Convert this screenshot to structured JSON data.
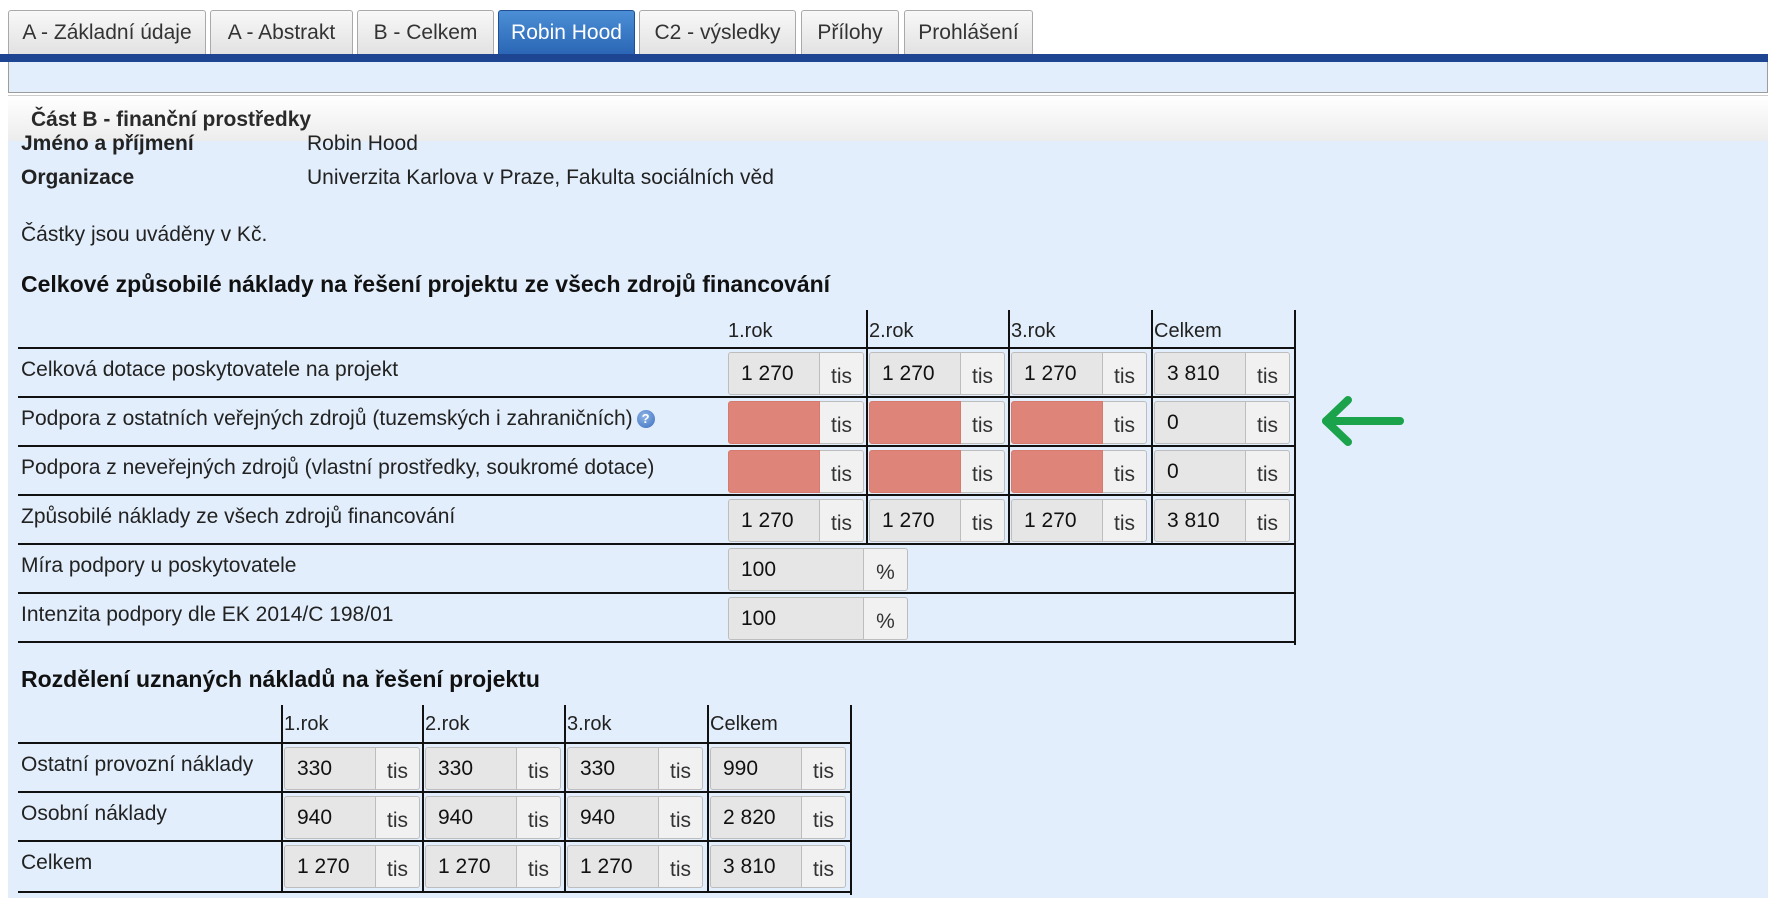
{
  "tabs": [
    {
      "label": "A - Základní údaje",
      "active": false
    },
    {
      "label": "A - Abstrakt",
      "active": false
    },
    {
      "label": "B - Celkem",
      "active": false
    },
    {
      "label": "Robin Hood",
      "active": true
    },
    {
      "label": "C2 - výsledky",
      "active": false
    },
    {
      "label": "Přílohy",
      "active": false
    },
    {
      "label": "Prohlášení",
      "active": false
    }
  ],
  "section_title": "Část B - finanční prostředky",
  "person": {
    "name_label": "Jméno a příjmení",
    "name_value": "Robin Hood",
    "org_label": "Organizace",
    "org_value": "Univerzita Karlova v Praze, Fakulta sociálních věd",
    "note": "Částky jsou uváděny v Kč."
  },
  "costs_table": {
    "heading": "Celkové způsobilé náklady na řešení projektu ze všech zdrojů financování",
    "columns": [
      "1.rok",
      "2.rok",
      "3.rok",
      "Celkem"
    ],
    "unit": "tis",
    "rows": [
      {
        "label": "Celková dotace poskytovatele na projekt",
        "values": [
          "1 270",
          "1 270",
          "1 270",
          "3 810"
        ]
      },
      {
        "label": "Podpora z ostatních veřejných zdrojů (tuzemských i zahraničních)",
        "values": [
          "",
          "",
          "",
          "0"
        ]
      },
      {
        "label": "Podpora z neveřejných zdrojů (vlastní prostředky, soukromé dotace)",
        "values": [
          "",
          "",
          "",
          "0"
        ]
      },
      {
        "label": "Způsobilé náklady ze všech zdrojů financování",
        "values": [
          "1 270",
          "1 270",
          "1 270",
          "3 810"
        ]
      }
    ],
    "rate_rows": [
      {
        "label": "Míra podpory u poskytovatele",
        "value": "100",
        "unit": "%"
      },
      {
        "label": "Intenzita podpory dle EK 2014/C 198/01",
        "value": "100",
        "unit": "%"
      }
    ]
  },
  "split_table": {
    "heading": "Rozdělení uznaných nákladů na řešení projektu",
    "columns": [
      "1.rok",
      "2.rok",
      "3.rok",
      "Celkem"
    ],
    "unit": "tis",
    "rows": [
      {
        "label": "Ostatní provozní náklady",
        "values": [
          "330",
          "330",
          "330",
          "990"
        ]
      },
      {
        "label": "Osobní náklady",
        "values": [
          "940",
          "940",
          "940",
          "2 820"
        ]
      },
      {
        "label": "Celkem",
        "values": [
          "1 270",
          "1 270",
          "1 270",
          "3 810"
        ]
      }
    ]
  },
  "colors": {
    "tab_active": "#2f6fbf",
    "empty_field": "#df8478",
    "arrow": "#1aa34a",
    "panel_bg": "#e2eefb"
  },
  "icons": {
    "help": "help-icon",
    "arrow": "arrow-left-icon"
  }
}
